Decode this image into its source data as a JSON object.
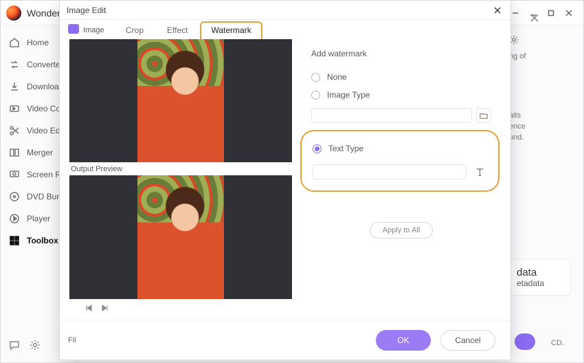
{
  "app": {
    "title": "Wonder"
  },
  "sidebar": {
    "items": [
      {
        "label": "Home"
      },
      {
        "label": "Converter"
      },
      {
        "label": "Downloader"
      },
      {
        "label": "Video Compressor"
      },
      {
        "label": "Video Editor"
      },
      {
        "label": "Merger"
      },
      {
        "label": "Screen Recorder"
      },
      {
        "label": "DVD Burner"
      },
      {
        "label": "Player"
      },
      {
        "label": "Toolbox"
      }
    ]
  },
  "bg": {
    "snippet_word": "ng of",
    "snippet_line1": "aits",
    "snippet_line2": "ence",
    "snippet_line3": "und.",
    "data_big": "data",
    "data_small": "etadata",
    "cd_label": "CD."
  },
  "modal": {
    "title": "Image Edit",
    "row_label": "Image",
    "tabs": [
      {
        "label": "Crop"
      },
      {
        "label": "Effect"
      },
      {
        "label": "Watermark"
      }
    ],
    "output_preview_label": "Output Preview",
    "watermark": {
      "heading": "Add watermark",
      "options": {
        "none": "None",
        "image": "Image Type",
        "text": "Text Type"
      },
      "text_value": "",
      "image_path": ""
    },
    "apply_all": "Apply to All",
    "ok": "OK",
    "cancel": "Cancel",
    "file_label": "Fil"
  }
}
